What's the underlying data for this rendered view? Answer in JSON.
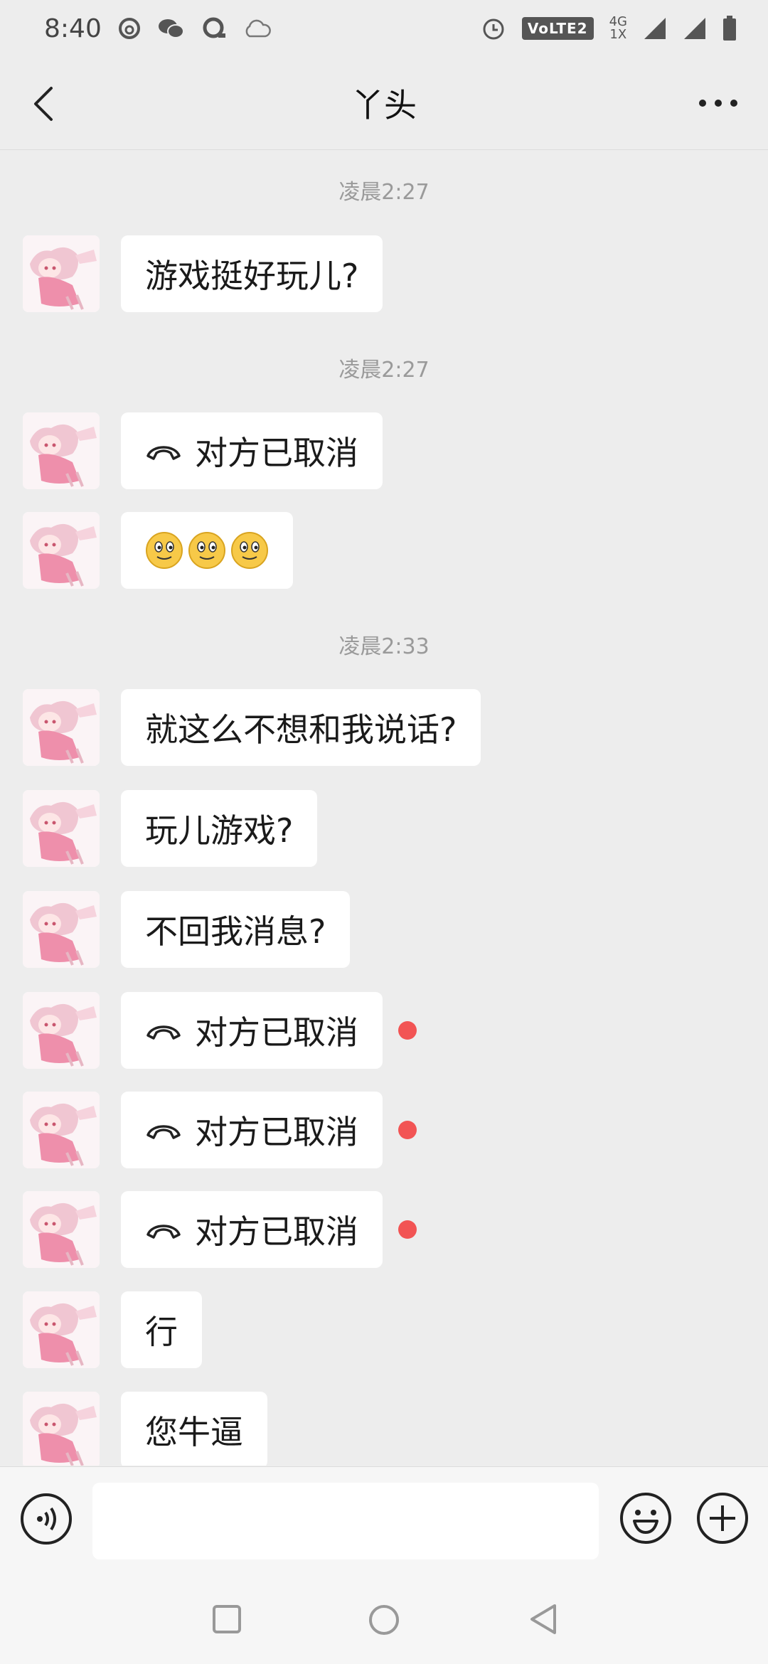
{
  "status_bar": {
    "time": "8:40",
    "volte_label": "VoLTE2",
    "net_top": "4G",
    "net_bottom": "1X",
    "left_icons": [
      "netease-music-icon",
      "wechat-icon",
      "qq-browser-icon",
      "cloud-icon"
    ],
    "right_icons": [
      "alarm-icon",
      "signal-icon",
      "signal-icon",
      "battery-icon"
    ]
  },
  "header": {
    "title": "丫头",
    "back_icon": "chevron-left-icon",
    "more_icon": "more-dots-icon"
  },
  "chat": {
    "timestamps": [
      "凌晨2:27",
      "凌晨2:27",
      "凌晨2:33"
    ],
    "messages": [
      {
        "type": "text",
        "text": "游戏挺好玩儿?"
      },
      {
        "type": "call",
        "text": "对方已取消",
        "unread": false
      },
      {
        "type": "emoji",
        "emojis": [
          "smile-emoji",
          "smile-emoji",
          "smile-emoji"
        ]
      },
      {
        "type": "text",
        "text": "就这么不想和我说话?"
      },
      {
        "type": "text",
        "text": "玩儿游戏?"
      },
      {
        "type": "text",
        "text": "不回我消息?"
      },
      {
        "type": "call",
        "text": "对方已取消",
        "unread": true
      },
      {
        "type": "call",
        "text": "对方已取消",
        "unread": true
      },
      {
        "type": "call",
        "text": "对方已取消",
        "unread": true
      },
      {
        "type": "text",
        "text": "行"
      },
      {
        "type": "text",
        "text": "您牛逼"
      }
    ]
  },
  "input_bar": {
    "value": "",
    "voice_icon": "voice-icon",
    "emoji_icon": "emoji-icon",
    "plus_icon": "plus-icon"
  },
  "nav_bar": {
    "icons": [
      "recent-apps-icon",
      "home-icon",
      "back-icon"
    ]
  },
  "colors": {
    "background": "#ededed",
    "bubble": "#ffffff",
    "unread_dot": "#f25454",
    "timestamp": "#9a9a9a"
  }
}
